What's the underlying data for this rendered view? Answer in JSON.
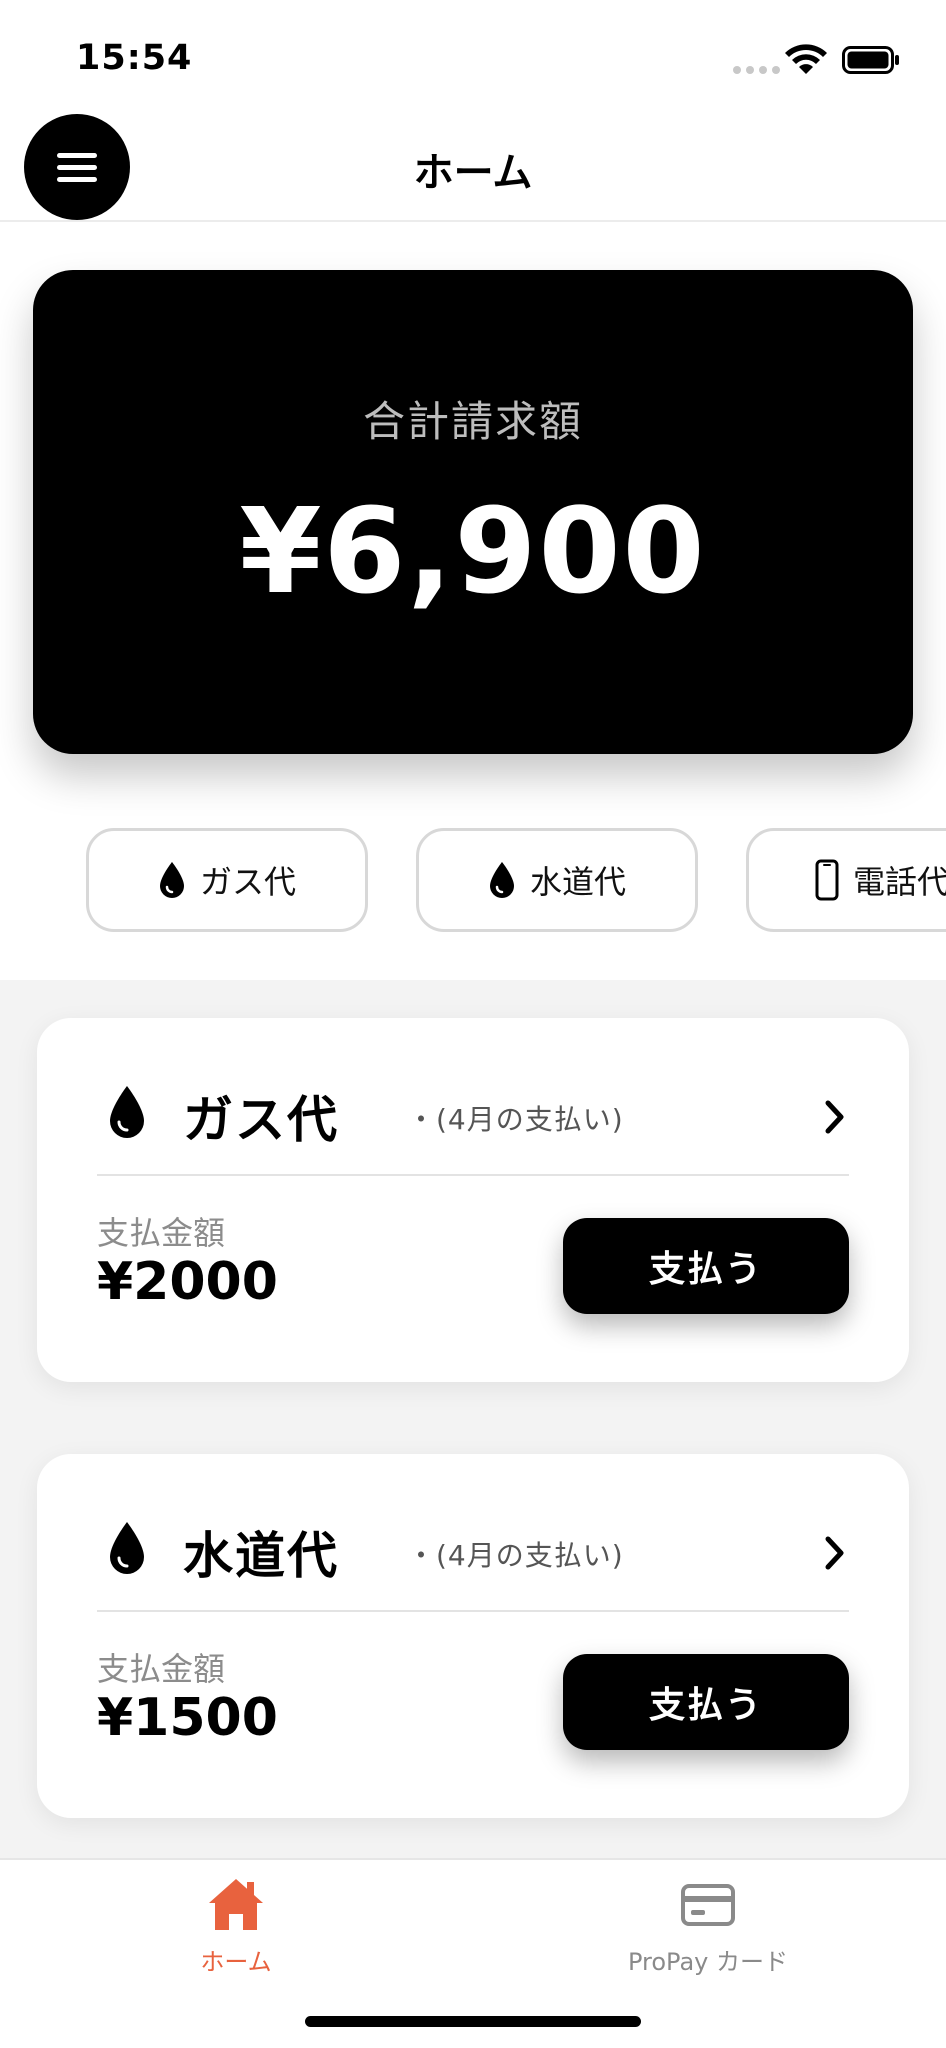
{
  "status_bar": {
    "time": "15:54"
  },
  "header": {
    "title": "ホーム"
  },
  "summary": {
    "label": "合計請求額",
    "amount": "¥6,900"
  },
  "categories": [
    {
      "label": "ガス代",
      "icon": "drop-icon"
    },
    {
      "label": "水道代",
      "icon": "drop-icon"
    },
    {
      "label": "電話代",
      "icon": "phone-icon"
    }
  ],
  "bills": [
    {
      "name": "ガス代",
      "period": "・(4月の支払い)",
      "amount_label": "支払金額",
      "amount": "¥2000",
      "pay_label": "支払う",
      "icon": "drop-icon"
    },
    {
      "name": "水道代",
      "period": "・(4月の支払い)",
      "amount_label": "支払金額",
      "amount": "¥1500",
      "pay_label": "支払う",
      "icon": "drop-icon"
    }
  ],
  "tab_bar": {
    "home_label": "ホーム",
    "card_label": "ProPay カード",
    "active": "home"
  },
  "colors": {
    "accent": "#e8623e",
    "card_bg": "#000000",
    "list_bg": "#f3f3f3"
  }
}
